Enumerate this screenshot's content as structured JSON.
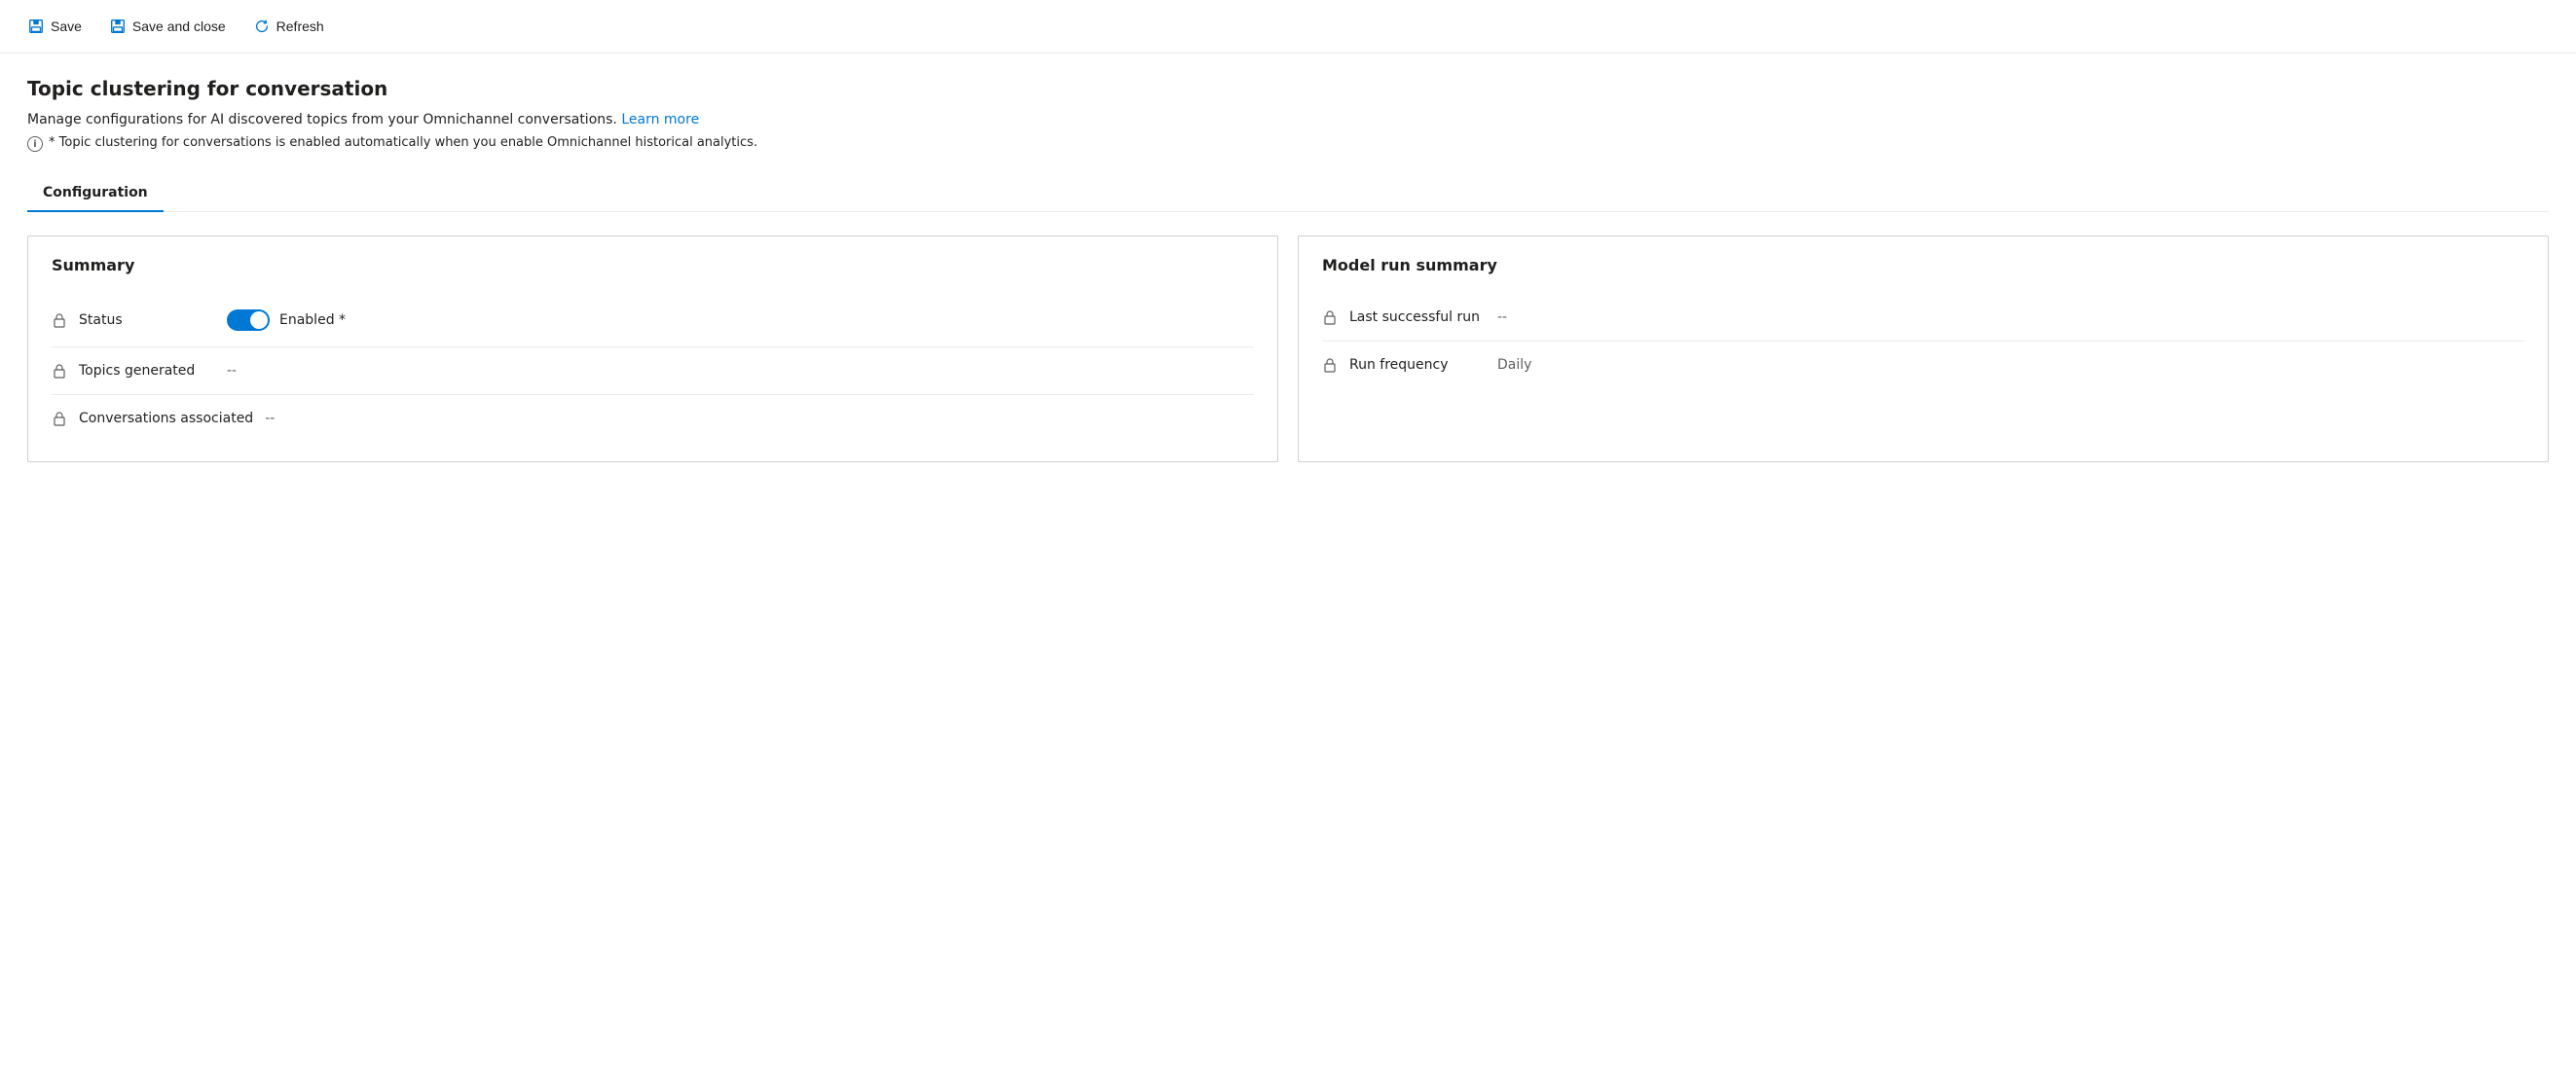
{
  "toolbar": {
    "save_label": "Save",
    "save_close_label": "Save and close",
    "refresh_label": "Refresh"
  },
  "page": {
    "title": "Topic clustering for conversation",
    "description": "Manage configurations for AI discovered topics from your Omnichannel conversations.",
    "learn_more": "Learn more",
    "info_text": "* Topic clustering for conversations is enabled automatically when you enable Omnichannel historical analytics."
  },
  "tabs": [
    {
      "label": "Configuration",
      "active": true
    }
  ],
  "summary_card": {
    "title": "Summary",
    "fields": [
      {
        "label": "Status",
        "type": "toggle",
        "toggle_value": true,
        "toggle_label": "Enabled *"
      },
      {
        "label": "Topics generated",
        "value": "--"
      },
      {
        "label": "Conversations associated",
        "value": "--"
      }
    ]
  },
  "model_run_card": {
    "title": "Model run summary",
    "fields": [
      {
        "label": "Last successful run",
        "value": "--"
      },
      {
        "label": "Run frequency",
        "value": "Daily"
      }
    ]
  }
}
